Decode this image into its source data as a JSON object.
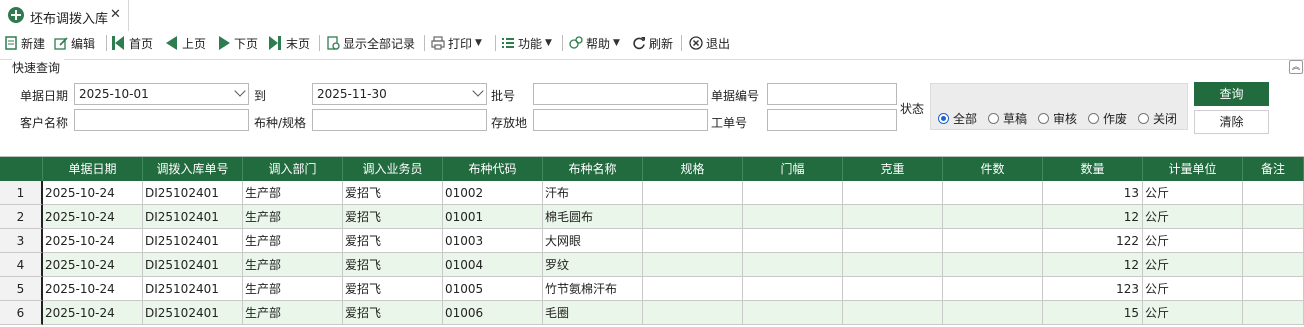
{
  "tab": {
    "title": "坯布调拨入库",
    "close_glyph": "✕"
  },
  "toolbar": {
    "new": "新建",
    "edit": "编辑",
    "first": "首页",
    "prev": "上页",
    "next": "下页",
    "last": "末页",
    "show_all": "显示全部记录",
    "print": "打印",
    "function": "功能",
    "help": "帮助",
    "refresh": "刷新",
    "exit": "退出"
  },
  "query": {
    "title": "快速查询",
    "date_label": "单据日期",
    "date_from": "2025-10-01",
    "to_label": "到",
    "date_to": "2025-11-30",
    "batch_label": "批号",
    "batch_value": "",
    "doc_no_label": "单据编号",
    "doc_no_value": "",
    "status_label": "状态",
    "customer_label": "客户名称",
    "customer_value": "",
    "fabric_label": "布种/规格",
    "fabric_value": "",
    "location_label": "存放地",
    "location_value": "",
    "workorder_label": "工单号",
    "workorder_value": "",
    "status_options": [
      "全部",
      "草稿",
      "审核",
      "作废",
      "关闭"
    ],
    "status_selected": "全部",
    "query_button": "查询",
    "clear_button": "清除"
  },
  "grid": {
    "columns": [
      "",
      "单据日期",
      "调拨入库单号",
      "调入部门",
      "调入业务员",
      "布种代码",
      "布种名称",
      "规格",
      "门幅",
      "克重",
      "件数",
      "数量",
      "计量单位",
      "备注"
    ],
    "rows": [
      [
        "1",
        "2025-10-24",
        "DI25102401",
        "生产部",
        "爱招飞",
        "01002",
        "汗布",
        "",
        "",
        "",
        "",
        "13",
        "公斤",
        ""
      ],
      [
        "2",
        "2025-10-24",
        "DI25102401",
        "生产部",
        "爱招飞",
        "01001",
        "棉毛圆布",
        "",
        "",
        "",
        "",
        "12",
        "公斤",
        ""
      ],
      [
        "3",
        "2025-10-24",
        "DI25102401",
        "生产部",
        "爱招飞",
        "01003",
        "大网眼",
        "",
        "",
        "",
        "",
        "122",
        "公斤",
        ""
      ],
      [
        "4",
        "2025-10-24",
        "DI25102401",
        "生产部",
        "爱招飞",
        "01004",
        "罗纹",
        "",
        "",
        "",
        "",
        "12",
        "公斤",
        ""
      ],
      [
        "5",
        "2025-10-24",
        "DI25102401",
        "生产部",
        "爱招飞",
        "01005",
        "竹节氨棉汗布",
        "",
        "",
        "",
        "",
        "123",
        "公斤",
        ""
      ],
      [
        "6",
        "2025-10-24",
        "DI25102401",
        "生产部",
        "爱招飞",
        "01006",
        "毛圈",
        "",
        "",
        "",
        "",
        "15",
        "公斤",
        ""
      ]
    ]
  },
  "colors": {
    "header_green": "#226b3f",
    "row_alt": "#eaf6ea"
  }
}
